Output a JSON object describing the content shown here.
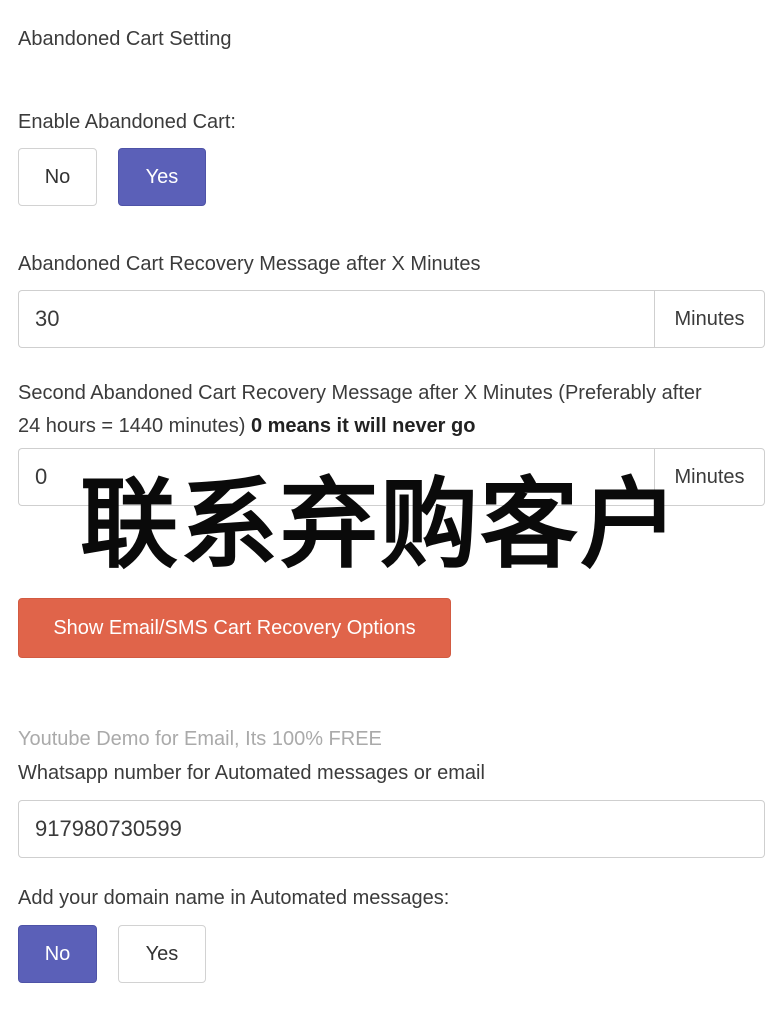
{
  "settings": {
    "title": "Abandoned Cart Setting",
    "enable_label": "Enable Abandoned Cart:",
    "enable_toggle": {
      "no": "No",
      "yes": "Yes",
      "selected": "Yes"
    },
    "first_message": {
      "label": "Abandoned Cart Recovery Message after X Minutes",
      "value": "30",
      "unit": "Minutes"
    },
    "second_message": {
      "label_line1": "Second Abandoned Cart Recovery Message after X Minutes (Preferably after",
      "label_line2": "24 hours = 1440 minutes)",
      "label_bold": "0 means it will never go",
      "value": "0",
      "unit": "Minutes"
    },
    "recovery_button": "Show Email/SMS Cart Recovery Options",
    "demo_link": "Youtube Demo for Email, Its 100% FREE",
    "whatsapp": {
      "label": "Whatsapp number for Automated messages or email",
      "value": "917980730599"
    },
    "domain": {
      "label": "Add your domain name in Automated messages:",
      "no": "No",
      "yes": "Yes",
      "selected": "No"
    }
  },
  "overlay": {
    "caption": "联系弃购客户"
  },
  "colors": {
    "selected_toggle": "#5b60b8",
    "recovery_button": "#e0644a",
    "demo_link": "#aaaaaa"
  }
}
